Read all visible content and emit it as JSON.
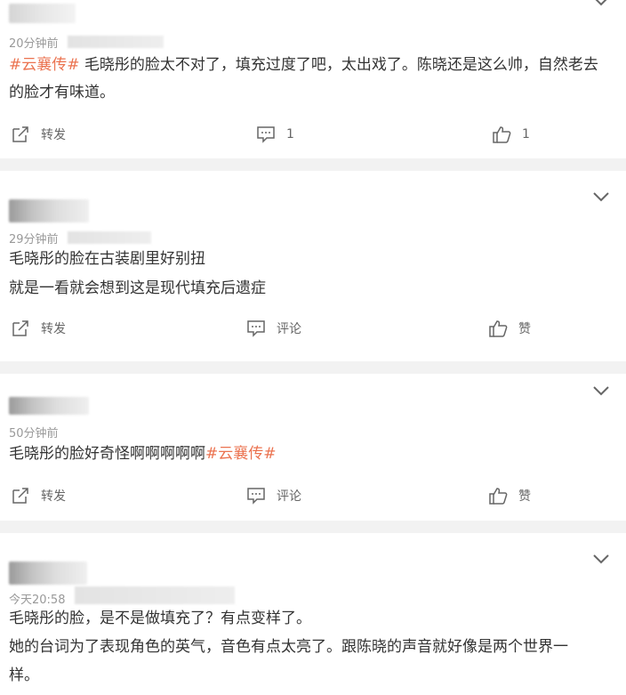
{
  "comments": [
    {
      "time": "20分钟前",
      "topic": "#云襄传#",
      "text": " 毛晓彤的脸太不对了，填充过度了吧，太出戏了。陈晓还是这么帅，自然老去",
      "text2": "的脸才有味道。",
      "forward": "转发",
      "comment": "1",
      "like": "1"
    },
    {
      "time": "29分钟前",
      "line1": "毛晓彤的脸在古装剧里好别扭",
      "line2": "就是一看就会想到这是现代填充后遗症",
      "forward": "转发",
      "comment": "评论",
      "like": "赞"
    },
    {
      "time": "50分钟前",
      "text": "毛晓彤的脸好奇怪啊啊啊啊啊",
      "topic": "#云襄传#",
      "forward": "转发",
      "comment": "评论",
      "like": "赞"
    },
    {
      "time": "今天20:58",
      "line1": "毛晓彤的脸，是不是做填充了？有点变样了。",
      "line2": "她的台词为了表现角色的英气，音色有点太亮了。跟陈晓的声音就好像是两个世界一",
      "line3": "样。"
    }
  ],
  "icons": [
    "chevron-down-icon",
    "forward-icon",
    "comment-icon",
    "like-icon"
  ],
  "colors": {
    "topic": "#eb7350",
    "separator": "#f2f2f2",
    "meta": "#999999"
  }
}
